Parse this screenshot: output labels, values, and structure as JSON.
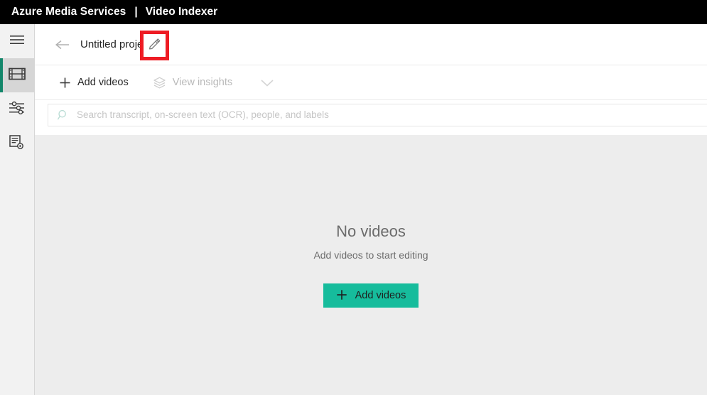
{
  "topbar": {
    "brand": "Azure Media Services",
    "separator": "|",
    "product": "Video Indexer"
  },
  "sidebar": {
    "items": [
      {
        "icon": "hamburger-menu-icon",
        "name": "menu",
        "selected": false
      },
      {
        "icon": "film-strip-icon",
        "name": "media",
        "selected": true
      },
      {
        "icon": "sliders-icon",
        "name": "model-customization",
        "selected": false
      },
      {
        "icon": "document-settings-icon",
        "name": "account-settings",
        "selected": false
      }
    ],
    "accent_color": "#12866a",
    "selected_background": "#d6d6d6"
  },
  "title_row": {
    "back_icon": "back-arrow-icon",
    "project_name": "Untitled project",
    "edit_icon": "pencil-edit-icon",
    "highlight_color": "#ee1c24"
  },
  "toolbar": {
    "add_videos_label": "Add videos",
    "add_videos_icon": "plus-icon",
    "view_insights_label": "View insights",
    "view_insights_icon": "layers-icon",
    "view_insights_disabled": true,
    "chevron_icon": "chevron-down-icon"
  },
  "search": {
    "icon": "search-icon",
    "placeholder": "Search transcript, on-screen text (OCR), people, and labels",
    "value": ""
  },
  "empty_state": {
    "title": "No videos",
    "subtitle": "Add videos to start editing",
    "button_label": "Add videos",
    "button_icon": "plus-icon",
    "button_color": "#16bc9c"
  }
}
